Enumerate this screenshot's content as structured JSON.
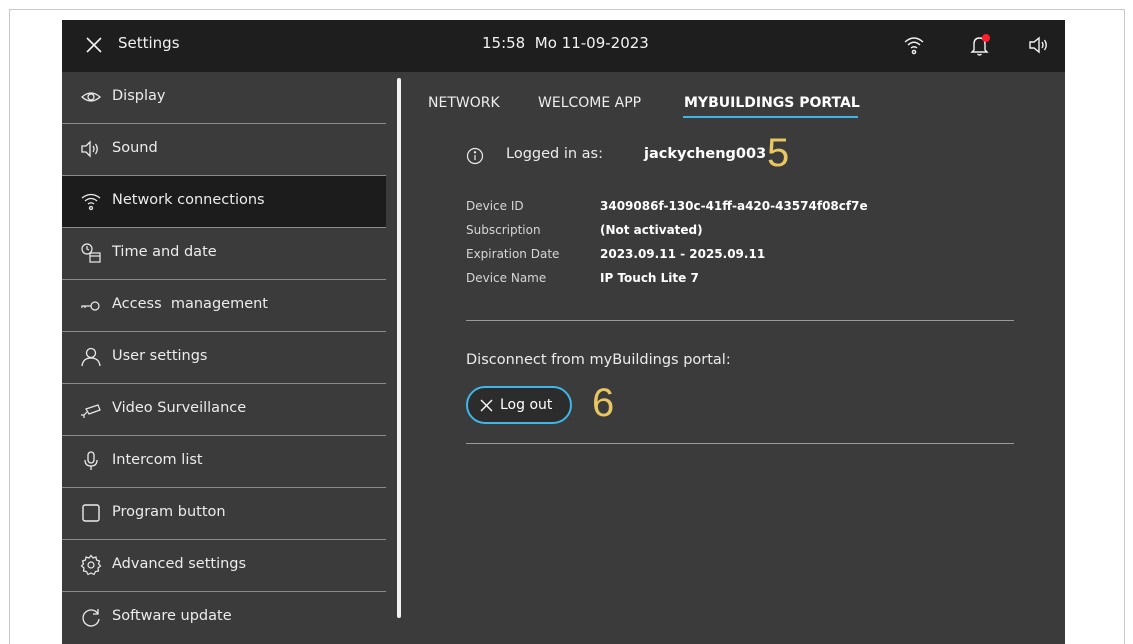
{
  "topbar": {
    "title": "Settings",
    "clock": "15:58  Mo 11-09-2023",
    "icons": [
      "close-icon",
      "wifi-icon",
      "bell-icon",
      "volume-icon"
    ],
    "notification_dot_color": "#ff1e2d"
  },
  "sidebar": {
    "items": [
      {
        "label": "Display",
        "icon": "eye-icon",
        "selected": false
      },
      {
        "label": "Sound",
        "icon": "speaker-icon",
        "selected": false
      },
      {
        "label": "Network connections",
        "icon": "wifi-icon",
        "selected": true
      },
      {
        "label": "Time and date",
        "icon": "clock-calendar-icon",
        "selected": false
      },
      {
        "label": "Access  management",
        "icon": "key-icon",
        "selected": false
      },
      {
        "label": "User settings",
        "icon": "user-icon",
        "selected": false
      },
      {
        "label": "Video Surveillance",
        "icon": "camera-icon",
        "selected": false
      },
      {
        "label": "Intercom list",
        "icon": "microphone-icon",
        "selected": false
      },
      {
        "label": "Program button",
        "icon": "square-icon",
        "selected": false
      },
      {
        "label": "Advanced settings",
        "icon": "gear-icon",
        "selected": false
      },
      {
        "label": "Software update",
        "icon": "refresh-icon",
        "selected": false
      }
    ]
  },
  "tabs": [
    {
      "label": "NETWORK",
      "active": false
    },
    {
      "label": "WELCOME APP",
      "active": false
    },
    {
      "label": "MYBUILDINGS PORTAL",
      "active": true
    }
  ],
  "portal": {
    "logged_in_label": "Logged in as:",
    "username": "jackycheng003",
    "details": [
      {
        "label": "Device ID",
        "value": "3409086f-130c-41ff-a420-43574f08cf7e"
      },
      {
        "label": "Subscription",
        "value": "(Not activated)"
      },
      {
        "label": "Expiration Date",
        "value": "2023.09.11 - 2025.09.11"
      },
      {
        "label": "Device Name",
        "value": "IP Touch Lite 7"
      }
    ],
    "disconnect_label": "Disconnect from myBuildings portal:",
    "logout_label": "Log out"
  },
  "callouts": [
    "5",
    "6"
  ],
  "colors": {
    "accent": "#3fb6e8",
    "callout": "#e7c663",
    "screen_bg": "#3b3b3b",
    "topbar_bg": "#1e1e1e"
  }
}
